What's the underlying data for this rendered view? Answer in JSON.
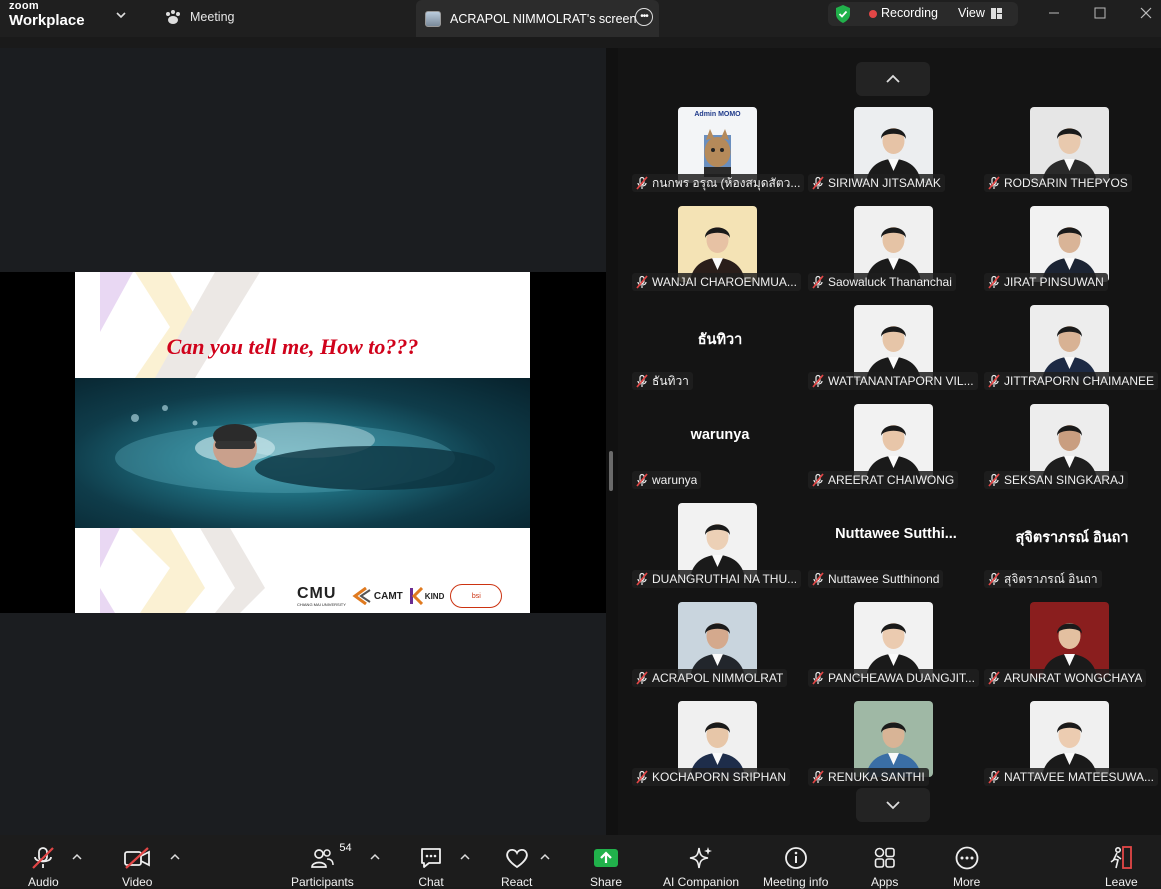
{
  "app": {
    "logo_line1": "zoom",
    "logo_line2": "Workplace"
  },
  "tabs": {
    "meeting": "Meeting",
    "screen_share": "ACRAPOL NIMMOLRAT's screen"
  },
  "status": {
    "recording": "Recording",
    "view": "View",
    "recording_color": "#e24646",
    "shield_color": "#21b14b"
  },
  "slide": {
    "title": "Can you tell me, How to???",
    "logos": {
      "cmu": "CMU",
      "cmu_sub": "CHIANG MAI UNIVERSITY",
      "camt": "CAMT",
      "kind": "KIND",
      "bsi": "bsi"
    }
  },
  "gallery": {
    "participants": [
      {
        "name": "กนกพร  อรุณ (ห้องสมุดสัตว...",
        "display": "",
        "muted": true
      },
      {
        "name": "SIRIWAN JITSAMAK",
        "display": "",
        "muted": true
      },
      {
        "name": "RODSARIN THEPYOS",
        "display": "",
        "muted": true
      },
      {
        "name": "WANJAI CHAROENMUA...",
        "display": "",
        "muted": true
      },
      {
        "name": "Saowaluck Thananchai",
        "display": "",
        "muted": true
      },
      {
        "name": "JIRAT PINSUWAN",
        "display": "",
        "muted": true
      },
      {
        "name": "ธันทิวา",
        "display": "ธันทิวา",
        "muted": true
      },
      {
        "name": "WATTANANTAPORN VIL...",
        "display": "",
        "muted": true
      },
      {
        "name": "JITTRAPORN CHAIMANEE",
        "display": "",
        "muted": true
      },
      {
        "name": "warunya",
        "display": "warunya",
        "muted": true
      },
      {
        "name": "AREERAT CHAIWONG",
        "display": "",
        "muted": true
      },
      {
        "name": "SEKSAN SINGKARAJ",
        "display": "",
        "muted": true
      },
      {
        "name": "DUANGRUTHAI NA THU...",
        "display": "",
        "muted": true
      },
      {
        "name": "Nuttawee Sutthinond",
        "display": "Nuttawee  Sutthi...",
        "muted": true
      },
      {
        "name": "สุจิตราภรณ์ อินถา",
        "display": "สุจิตราภรณ์ อินถา",
        "muted": true
      },
      {
        "name": "ACRAPOL NIMMOLRAT",
        "display": "",
        "muted": true
      },
      {
        "name": "PANCHEAWA DUANGJIT...",
        "display": "",
        "muted": true
      },
      {
        "name": "ARUNRAT WONGCHAYA",
        "display": "",
        "muted": true
      },
      {
        "name": "KOCHAPORN SRIPHAN",
        "display": "",
        "muted": true
      },
      {
        "name": "RENUKA SANTHI",
        "display": "",
        "muted": true
      },
      {
        "name": "NATTAVEE MATEESUWA...",
        "display": "",
        "muted": true
      }
    ],
    "admin_card_title": "Admin MOMO"
  },
  "toolbar": {
    "audio": "Audio",
    "video": "Video",
    "participants": "Participants",
    "participants_count": "54",
    "chat": "Chat",
    "react": "React",
    "share": "Share",
    "ai_companion": "AI Companion",
    "meeting_info": "Meeting info",
    "apps": "Apps",
    "more": "More",
    "leave": "Leave",
    "share_color": "#21b14b",
    "leave_color": "#e24646"
  }
}
